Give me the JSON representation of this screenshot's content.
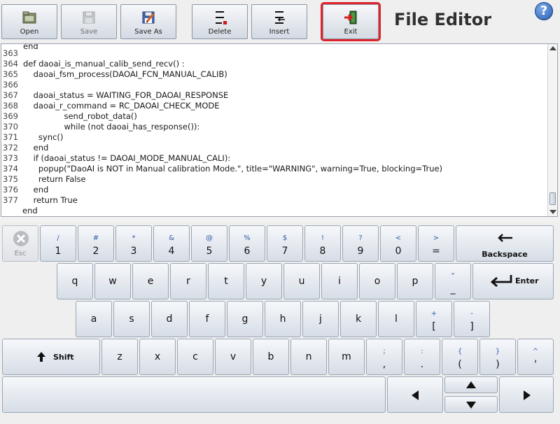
{
  "toolbar": {
    "open_label": "Open",
    "save_label": "Save",
    "saveas_label": "Save As",
    "delete_label": "Delete",
    "insert_label": "Insert",
    "exit_label": "Exit"
  },
  "title": "File Editor",
  "help_label": "?",
  "editor": {
    "top_line": "end",
    "line_numbers": [
      "363",
      "364",
      "365",
      "366",
      "367",
      "368",
      "369",
      "370",
      "371",
      "372",
      "373",
      "374",
      "375",
      "376",
      "377"
    ],
    "lines": [
      "def daoai_is_manual_calib_send_recv() :",
      "    daoai_fsm_process(DAOAI_FCN_MANUAL_CALIB)",
      "",
      "    daoai_status = WAITING_FOR_DAOAI_RESPONSE",
      "    daoai_r_command = RC_DAOAI_CHECK_MODE",
      "                send_robot_data()",
      "                while (not daoai_has_response()):",
      "      sync()",
      "    end",
      "    if (daoai_status != DAOAI_MODE_MANUAL_CALI):",
      "      popup(\"DaoAI is NOT in Manual calibration Mode.\", title=\"WARNING\", warning=True, blocking=True)",
      "      return False",
      "    end",
      "    return True",
      "end"
    ]
  },
  "keyboard": {
    "esc": "Esc",
    "row1": [
      {
        "sub": "/",
        "main": "1"
      },
      {
        "sub": "#",
        "main": "2"
      },
      {
        "sub": "*",
        "main": "3"
      },
      {
        "sub": "&",
        "main": "4"
      },
      {
        "sub": "@",
        "main": "5"
      },
      {
        "sub": "%",
        "main": "6"
      },
      {
        "sub": "$",
        "main": "7"
      },
      {
        "sub": "!",
        "main": "8"
      },
      {
        "sub": "?",
        "main": "9"
      },
      {
        "sub": "<",
        "main": "0"
      },
      {
        "sub": ">",
        "main": "="
      }
    ],
    "backspace": "Backspace",
    "row2": [
      "q",
      "w",
      "e",
      "r",
      "t",
      "y",
      "u",
      "i",
      "o",
      "p"
    ],
    "row2_extra": {
      "sub": "\"",
      "main": "_"
    },
    "enter": "Enter",
    "row3": [
      "a",
      "s",
      "d",
      "f",
      "g",
      "h",
      "j",
      "k",
      "l"
    ],
    "row3_extra": [
      {
        "sub": "+",
        "main": "["
      },
      {
        "sub": "-",
        "main": "]"
      }
    ],
    "shift": "Shift",
    "row4": [
      "z",
      "x",
      "c",
      "v",
      "b",
      "n",
      "m"
    ],
    "row4_extra": [
      {
        "sub": ";",
        "main": ","
      },
      {
        "sub": ":",
        "main": "."
      },
      {
        "sub": "{",
        "main": "("
      },
      {
        "sub": "}",
        "main": ")"
      },
      {
        "sub": "^",
        "main": "'"
      }
    ]
  }
}
